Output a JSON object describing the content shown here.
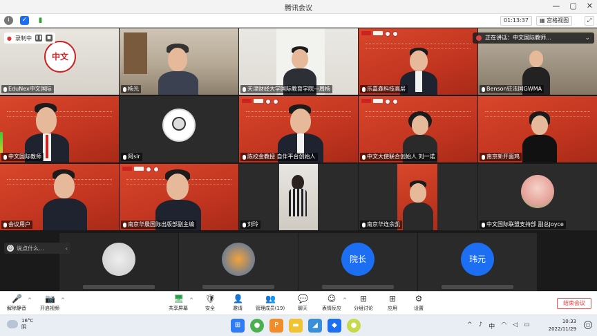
{
  "window": {
    "title": "腾讯会议"
  },
  "status_bar": {
    "timer": "01:13:37",
    "view_label": "▦ 宫格视图",
    "record_label": "录制中"
  },
  "speaking": {
    "label": "正在讲话：中文国际教师..."
  },
  "tiles": [
    {
      "name": "EduNex中文国际",
      "style": "logo"
    },
    {
      "name": "杨光",
      "style": "room"
    },
    {
      "name": "天津财经大学国际教育学院—周杨",
      "style": "wall"
    },
    {
      "name": "乐嘉森科技高层",
      "style": "red"
    },
    {
      "name": "Benson驻法国GWMA",
      "style": "room"
    },
    {
      "name": "中文国际教师",
      "style": "red"
    },
    {
      "name": "阿sir",
      "style": "gray"
    },
    {
      "name": "陈校金教授 自伴平台创始人",
      "style": "red"
    },
    {
      "name": "中文大使联合创始人 刘一诺",
      "style": "red"
    },
    {
      "name": "南京新开面鸡",
      "style": "red"
    },
    {
      "name": "会议用户",
      "style": "red"
    },
    {
      "name": "南京华晨国际出版部副主编",
      "style": "red"
    },
    {
      "name": "刘玲",
      "style": "light"
    },
    {
      "name": "南京华连余凯",
      "style": "red"
    },
    {
      "name": "中文国际联盟支持部 副总Joyce",
      "style": "gray"
    }
  ],
  "chat": {
    "placeholder": "说点什么..."
  },
  "row4_avatars": [
    {
      "text": ""
    },
    {
      "text": ""
    },
    {
      "text": "院长"
    },
    {
      "text": "玮元"
    }
  ],
  "toolbar": {
    "items": [
      {
        "label": "解除静音",
        "icon": "🎤"
      },
      {
        "label": "开启视频",
        "icon": "📷"
      },
      {
        "label": "共享屏幕",
        "icon": "🖥"
      },
      {
        "label": "安全",
        "icon": "🛡"
      },
      {
        "label": "邀请",
        "icon": "👤"
      },
      {
        "label": "管理成员(19)",
        "icon": "👥"
      },
      {
        "label": "聊天",
        "icon": "💬"
      },
      {
        "label": "表情反应",
        "icon": "☺"
      },
      {
        "label": "分组讨论",
        "icon": "⊞"
      },
      {
        "label": "应用",
        "icon": "⊞"
      },
      {
        "label": "设置",
        "icon": "⚙"
      }
    ],
    "leave_label": "结束会议"
  },
  "taskbar": {
    "weather_temp": "16°C",
    "weather_desc": "阴",
    "ime": "中",
    "time": "10:33",
    "date": "2022/11/29"
  },
  "colors": {
    "banner_red": "#c23520",
    "meeting_blue": "#1c6ef2",
    "leave_red": "#e33333"
  }
}
